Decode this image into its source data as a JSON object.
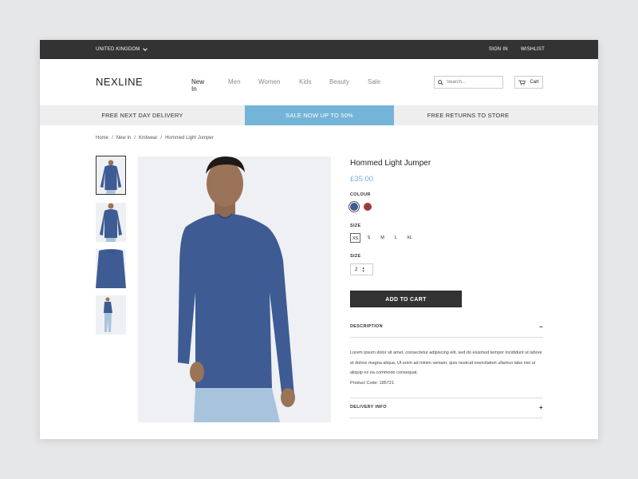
{
  "topbar": {
    "country": "UNITED KINGDOM",
    "sign_in": "SIGN IN",
    "wishlist": "WISHLIST"
  },
  "header": {
    "logo": "NEXLINE",
    "nav": [
      "New In",
      "Men",
      "Women",
      "Kids",
      "Beauty",
      "Sale"
    ],
    "active_nav": "New In",
    "search_placeholder": "Search...",
    "cart_label": "Cart"
  },
  "promo": {
    "left": "FREE NEXT DAY DELIVERY",
    "center": "SALE NOW UP TO 50%",
    "right": "FREE RETURNS TO STORE"
  },
  "breadcrumb": [
    "Home",
    "/",
    "New In",
    "/",
    "Knitwear",
    "/",
    "Hommed Light Jumper"
  ],
  "product": {
    "title": "Hommed Light Jumper",
    "price": "£35.00",
    "colour_label": "COLOUR",
    "colours": [
      "#3f5b94",
      "#9c3b3f"
    ],
    "size_label": "SIZE",
    "sizes": [
      "XS",
      "S",
      "M",
      "L",
      "XL"
    ],
    "selected_size": "XS",
    "quantity_label": "SIZE",
    "quantity": "2",
    "add_to_cart": "ADD TO CART",
    "description_label": "DESCRIPTION",
    "description_text": "Lorem ipsum dolor sit amet, consectetur adipiscing elit, sed do eiusmod tempor incididunt ut labore et dolore magna aliqua. Ut enim ad minim veniam, quis nostrud exercitation ullamco labo nisi ut aliquip ex ea commodo consequat.",
    "product_code": "Product Code: 185721",
    "delivery_label": "DELIVERY INFO",
    "collapse_sign": "−",
    "expand_sign": "+"
  },
  "colors": {
    "accent": "#74b4d8",
    "dark": "#333333",
    "sweater": "#3f5b94"
  }
}
